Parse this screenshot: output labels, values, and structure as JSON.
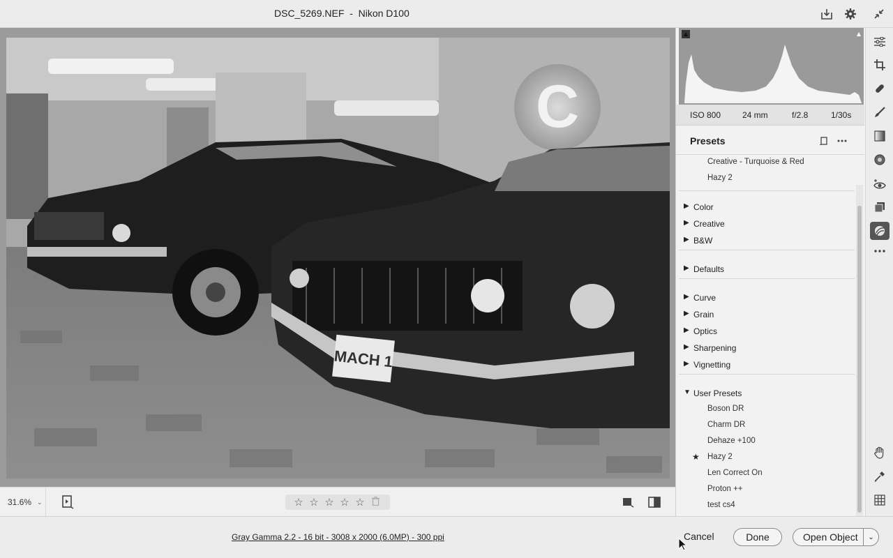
{
  "window": {
    "title": "DSC_5269.NEF  -  Nikon D100",
    "icons": [
      "save-image-icon",
      "settings-gear-icon",
      "collapse-fullscreen-icon"
    ]
  },
  "image": {
    "description_icon": "photo-canvas",
    "plate_text": "MACH 1",
    "badge_letter": "C"
  },
  "image_toolbar": {
    "zoom_value": "31.6%",
    "rating": 0,
    "rating_max": 5,
    "icons": [
      "filmstrip-toggle-icon",
      "star-icon",
      "trash-icon",
      "single-view-icon",
      "before-after-icon"
    ]
  },
  "histogram": {
    "exif": {
      "iso": "ISO 800",
      "focal": "24 mm",
      "aperture": "f/2.8",
      "shutter": "1/30s"
    }
  },
  "presets": {
    "title": "Presets",
    "top_items": [
      "Creative - Turquoise & Red",
      "Hazy 2"
    ],
    "groups_a": [
      "Color",
      "Creative",
      "B&W"
    ],
    "groups_b": [
      "Defaults"
    ],
    "groups_c": [
      "Curve",
      "Grain",
      "Optics",
      "Sharpening",
      "Vignetting"
    ],
    "user_group": "User Presets",
    "user_items": [
      "Boson DR",
      "Charm DR",
      "Dehaze +100",
      "Hazy 2",
      "Len Correct On",
      "Proton ++",
      "test cs4"
    ],
    "favorite_index": 3
  },
  "tools": [
    "edit-sliders-icon",
    "crop-icon",
    "healing-brush-icon",
    "brush-icon",
    "linear-gradient-icon",
    "radial-filter-icon",
    "red-eye-icon",
    "snapshots-icon",
    "presets-icon",
    "more-icon",
    "hand-icon",
    "color-sampler-icon",
    "grid-icon"
  ],
  "footer": {
    "workflow_link": "Gray Gamma 2.2 - 16 bit - 3008 x 2000 (6.0MP) - 300 ppi",
    "cancel": "Cancel",
    "done": "Done",
    "open_object": "Open Object"
  }
}
